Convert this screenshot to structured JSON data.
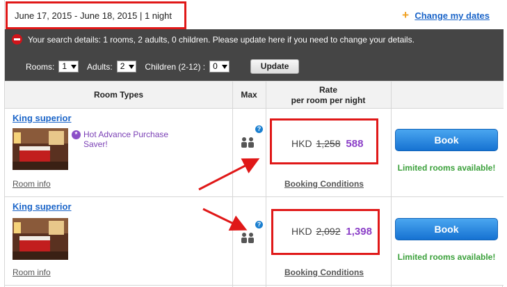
{
  "header": {
    "dates": "June 17, 2015 - June 18, 2015 | 1 night",
    "change_dates": "Change my dates",
    "plus_icon": "plus-icon"
  },
  "search": {
    "message": "Your search details: 1 rooms, 2 adults, 0 children. Please update here if you need to change your details.",
    "rooms_label": "Rooms:",
    "rooms_value": "1",
    "adults_label": "Adults:",
    "adults_value": "2",
    "children_label": "Children (2-12) :",
    "children_value": "0",
    "update_label": "Update"
  },
  "table": {
    "col_room_types": "Room Types",
    "col_max": "Max",
    "col_rate_line1": "Rate",
    "col_rate_line2": "per room per night"
  },
  "rows": [
    {
      "name": "King superior",
      "promo": "Hot Advance Purchase Saver!",
      "room_info": "Room info",
      "currency": "HKD",
      "old_price": "1,258",
      "new_price": "588",
      "booking_conditions": "Booking Conditions",
      "book_label": "Book",
      "limited": "Limited rooms available!"
    },
    {
      "name": "King superior",
      "promo": "",
      "room_info": "Room info",
      "currency": "HKD",
      "old_price": "2,092",
      "new_price": "1,398",
      "booking_conditions": "Booking Conditions",
      "book_label": "Book",
      "limited": "Limited rooms available!"
    }
  ],
  "colors": {
    "accent_blue": "#1a64c8",
    "promo_purple": "#8b3fc7",
    "annotation_red": "#e01818",
    "available_green": "#3aa03a"
  }
}
